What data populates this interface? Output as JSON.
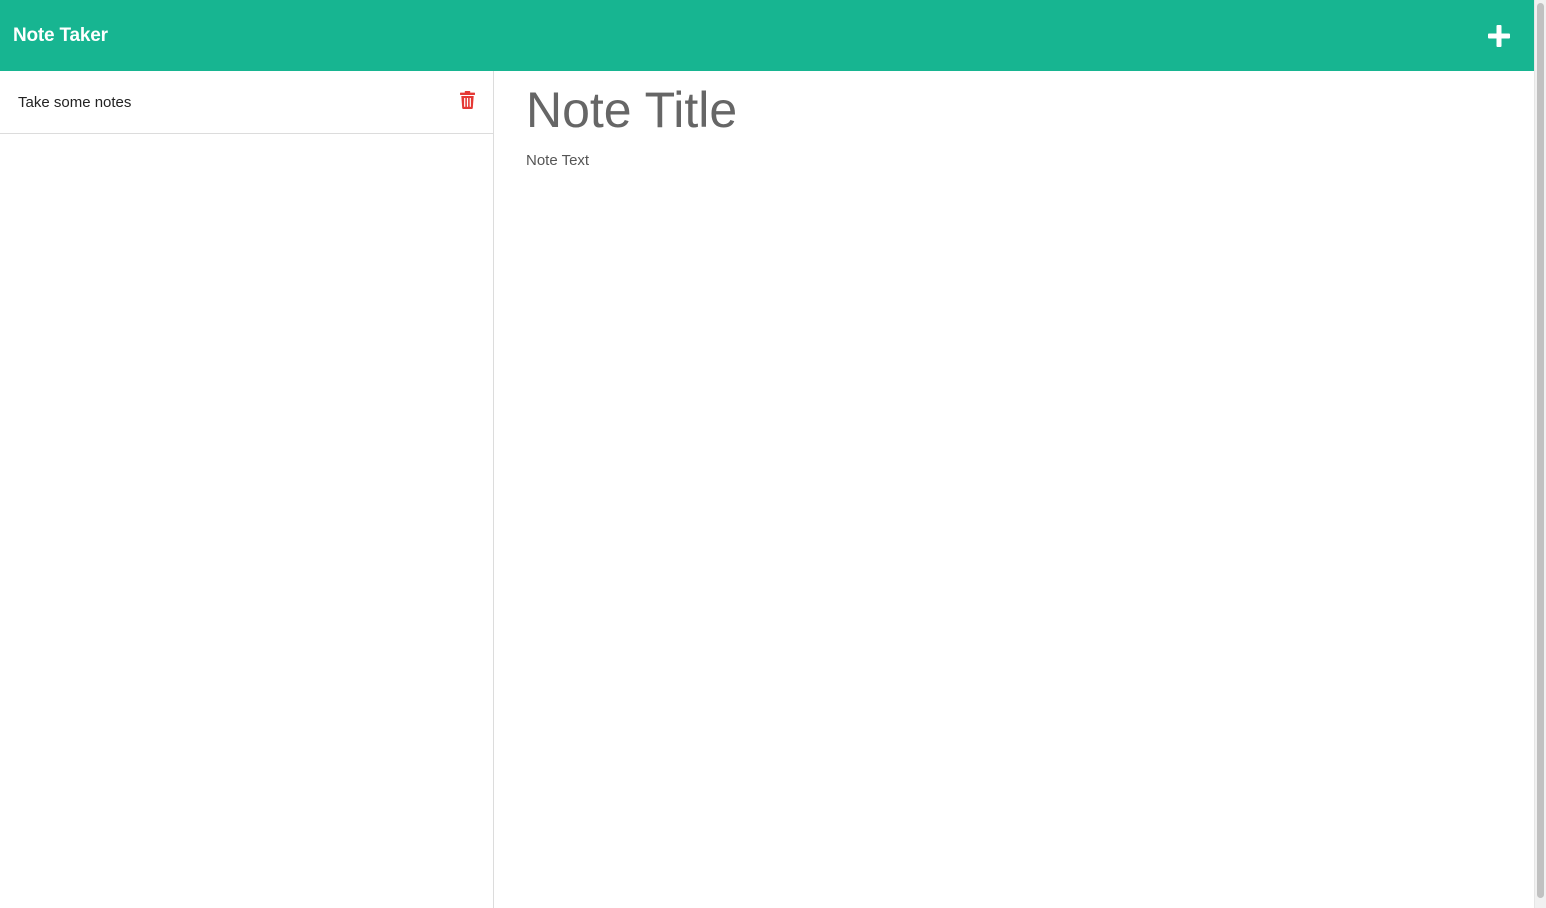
{
  "app": {
    "title": "Note Taker"
  },
  "navbar": {
    "brand": "Note Taker",
    "new_note_icon": "plus-icon",
    "accent_color": "#17b591"
  },
  "sidebar": {
    "notes": [
      {
        "label": "Take some notes",
        "delete_icon": "trash-icon"
      }
    ],
    "delete_color": "#e53935"
  },
  "editor": {
    "title_placeholder": "Note Title",
    "text_placeholder": "Note Text"
  }
}
